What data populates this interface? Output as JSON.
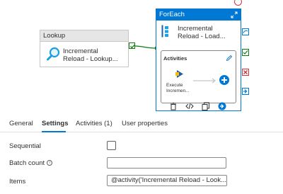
{
  "pipeline": {
    "lookup": {
      "header": "Lookup",
      "name_line1": "Incremental",
      "name_line2": "Reload - Lookup..."
    },
    "foreach": {
      "header": "ForEach",
      "name_line1": "Incremental",
      "name_line2": "Reload - Load...",
      "activities_label": "Activities",
      "inner_activity_line1": "Execute",
      "inner_activity_line2": "Incremen..."
    }
  },
  "icons": {
    "lookup_activity": "magnifier-icon",
    "success_check": "check-icon",
    "foreach_activity": "foreach-icon",
    "expand": "expand-icon",
    "edit": "pencil-icon",
    "execute_pipeline": "execute-pipeline-icon",
    "add": "plus-icon",
    "delete": "trash-icon",
    "code": "code-icon",
    "clone": "copy-icon",
    "go": "arrow-right-icon"
  },
  "tabs": [
    {
      "label": "General",
      "active": false
    },
    {
      "label": "Settings",
      "active": true
    },
    {
      "label": "Activities (1)",
      "active": false
    },
    {
      "label": "User properties",
      "active": false
    }
  ],
  "settings": {
    "sequential_label": "Sequential",
    "sequential_checked": false,
    "batch_count_label": "Batch count",
    "batch_count_value": "",
    "items_label": "Items",
    "items_value": "@activity('Incremental Reload - Look..."
  },
  "colors": {
    "accent": "#0078d4",
    "success": "#107c10",
    "failure": "#d13438"
  }
}
